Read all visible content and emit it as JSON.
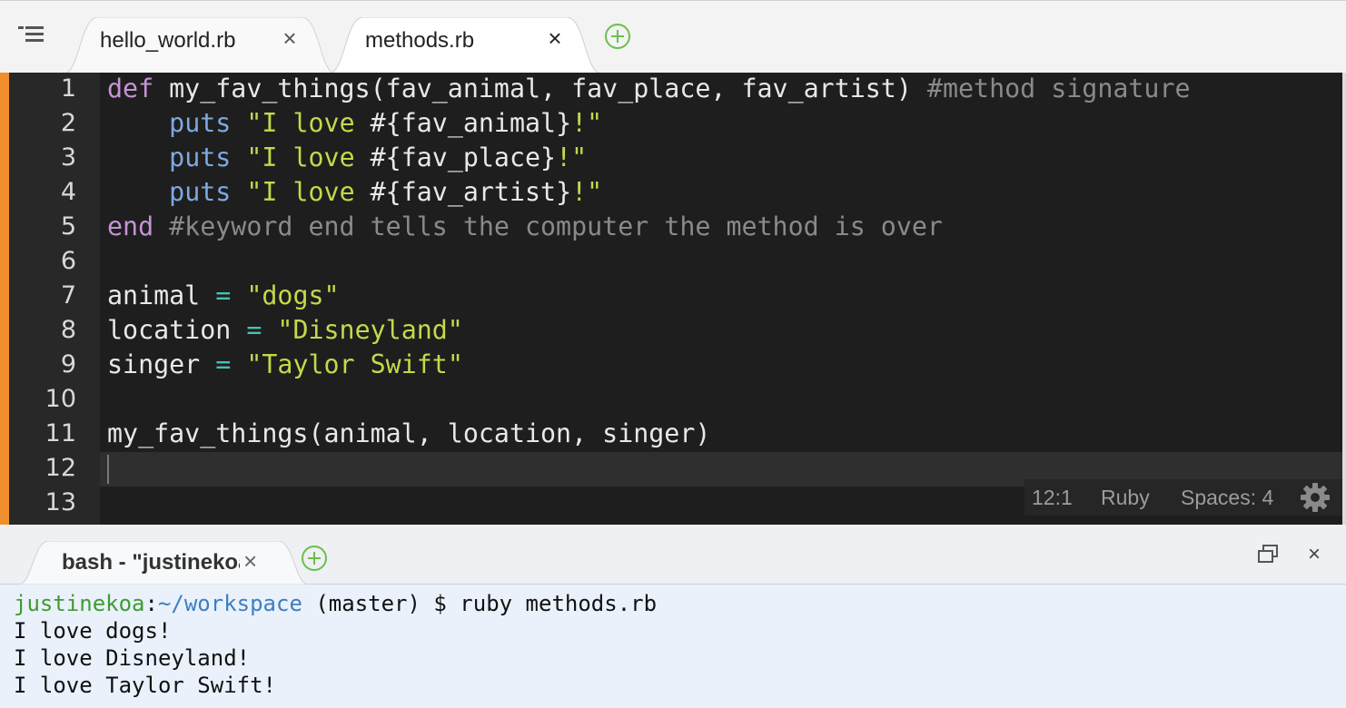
{
  "editor_tabs": [
    {
      "label": "hello_world.rb",
      "close": "×",
      "active": false
    },
    {
      "label": "methods.rb",
      "close": "×",
      "active": true
    }
  ],
  "code_lines": [
    {
      "number": "1",
      "tokens": [
        {
          "t": "def",
          "c": "kw"
        },
        {
          "t": " my_fav_things(fav_animal, fav_place, fav_artist) ",
          "c": "fn"
        },
        {
          "t": "#method signature",
          "c": "cm"
        }
      ]
    },
    {
      "number": "2",
      "tokens": [
        {
          "t": "    ",
          "c": "fn"
        },
        {
          "t": "puts",
          "c": "pt"
        },
        {
          "t": " \"I love ",
          "c": "str"
        },
        {
          "t": "#{fav_animal}",
          "c": "fn"
        },
        {
          "t": "!\"",
          "c": "str"
        }
      ]
    },
    {
      "number": "3",
      "tokens": [
        {
          "t": "    ",
          "c": "fn"
        },
        {
          "t": "puts",
          "c": "pt"
        },
        {
          "t": " \"I love ",
          "c": "str"
        },
        {
          "t": "#{fav_place}",
          "c": "fn"
        },
        {
          "t": "!\"",
          "c": "str"
        }
      ]
    },
    {
      "number": "4",
      "tokens": [
        {
          "t": "    ",
          "c": "fn"
        },
        {
          "t": "puts",
          "c": "pt"
        },
        {
          "t": " \"I love ",
          "c": "str"
        },
        {
          "t": "#{fav_artist}",
          "c": "fn"
        },
        {
          "t": "!\"",
          "c": "str"
        }
      ]
    },
    {
      "number": "5",
      "tokens": [
        {
          "t": "end",
          "c": "kw"
        },
        {
          "t": " #keyword end tells the computer the method is over",
          "c": "cm"
        }
      ]
    },
    {
      "number": "6",
      "tokens": []
    },
    {
      "number": "7",
      "tokens": [
        {
          "t": "animal ",
          "c": "fn"
        },
        {
          "t": "=",
          "c": "op"
        },
        {
          "t": " \"dogs\"",
          "c": "str"
        }
      ]
    },
    {
      "number": "8",
      "tokens": [
        {
          "t": "location ",
          "c": "fn"
        },
        {
          "t": "=",
          "c": "op"
        },
        {
          "t": " \"Disneyland\"",
          "c": "str"
        }
      ]
    },
    {
      "number": "9",
      "tokens": [
        {
          "t": "singer ",
          "c": "fn"
        },
        {
          "t": "=",
          "c": "op"
        },
        {
          "t": " \"Taylor Swift\"",
          "c": "str"
        }
      ]
    },
    {
      "number": "10",
      "tokens": []
    },
    {
      "number": "11",
      "tokens": [
        {
          "t": "my_fav_things(animal, location, singer)",
          "c": "fn"
        }
      ]
    },
    {
      "number": "12",
      "tokens": []
    },
    {
      "number": "13",
      "tokens": []
    }
  ],
  "status": {
    "position": "12:1",
    "language": "Ruby",
    "indent": "Spaces: 4"
  },
  "terminal": {
    "tab_label": "bash - \"justinekoa@",
    "tab_close": "×",
    "window_close": "×",
    "prompt_user": "justinekoa",
    "prompt_sep": ":",
    "prompt_path": "~/workspace",
    "prompt_rest": " (master) $ ",
    "command": "ruby methods.rb",
    "output": [
      "I love dogs!",
      "I love Disneyland!",
      "I love Taylor Swift!"
    ]
  },
  "colors": {
    "accent_modified": "#f0902c",
    "editor_bg": "#1e1e1e",
    "terminal_bg": "#eaf1fb",
    "prompt_user": "#3e9b33",
    "prompt_path": "#3c7fc2"
  },
  "icons": [
    "menu-icon",
    "add-tab-icon",
    "gear-icon",
    "restore-icon",
    "close-icon"
  ]
}
